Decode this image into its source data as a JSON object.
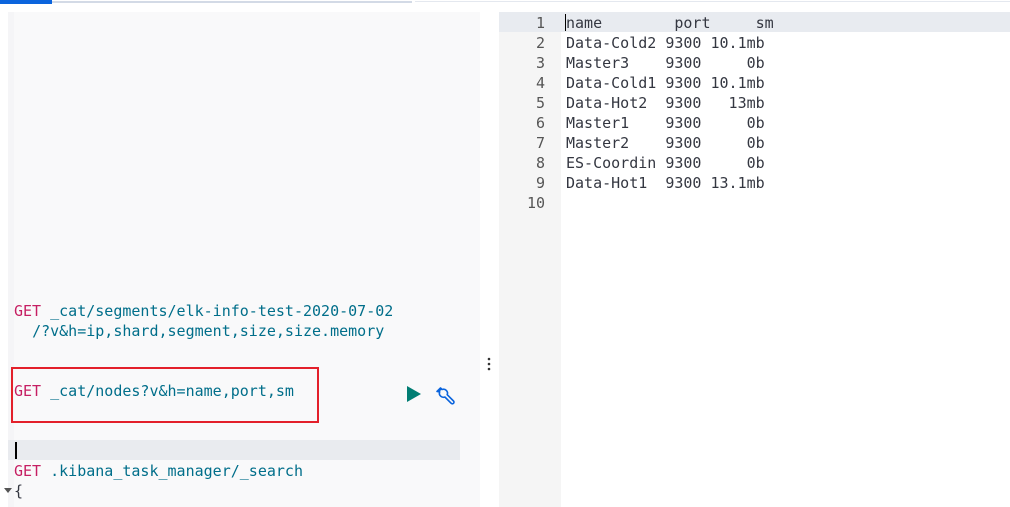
{
  "request": {
    "line1_method": "GET",
    "line1_path": "_cat/segments/elk-info-test-2020-07-02",
    "line1_cont": "/?v&h=ip,shard,segment,size,size.memory",
    "line2_method": "GET",
    "line2_path": "_cat/nodes?v&h=name,port,sm",
    "line3_method": "GET",
    "line3_path": ".kibana_task_manager/_search",
    "line4": "{"
  },
  "response": {
    "line_numbers": [
      "1",
      "2",
      "3",
      "4",
      "5",
      "6",
      "7",
      "8",
      "9",
      "10"
    ],
    "lines": [
      "name        port     sm",
      "Data-Cold2 9300 10.1mb",
      "Master3    9300     0b",
      "Data-Cold1 9300 10.1mb",
      "Data-Hot2  9300   13mb",
      "Master1    9300     0b",
      "Master2    9300     0b",
      "ES-Coordin 9300     0b",
      "Data-Hot1  9300 13.1mb",
      ""
    ]
  },
  "icons": {
    "run": "play-icon",
    "settings": "wrench-icon",
    "resizer": "vertical-ellipsis-icon",
    "fold": "fold-arrow-icon"
  },
  "colors": {
    "method": "#c61f63",
    "path": "#006e8a",
    "run": "#017d73",
    "wrench": "#0b64dd",
    "highlight_box": "#e3202a"
  }
}
